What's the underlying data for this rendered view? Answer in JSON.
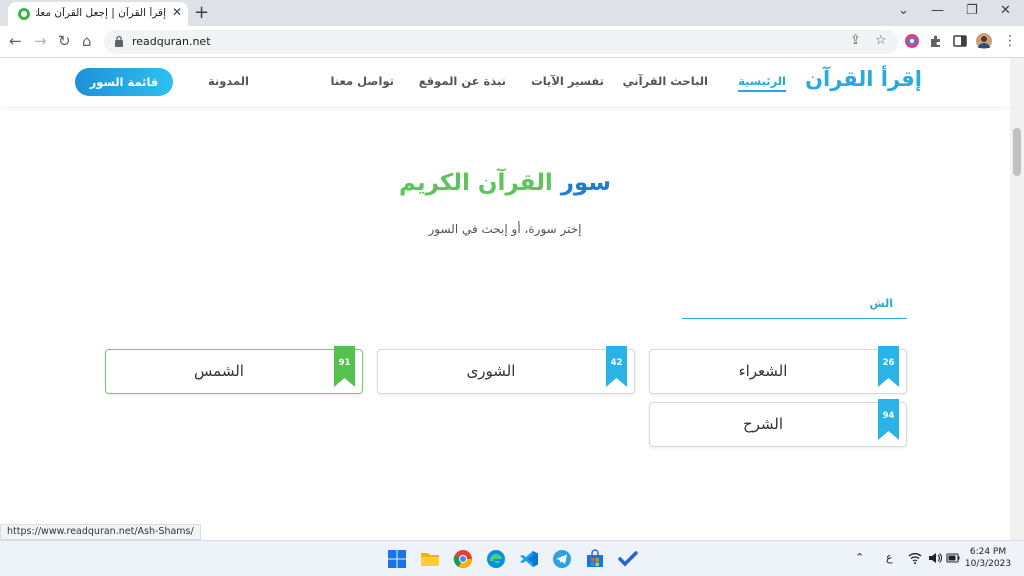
{
  "browser": {
    "tab_title": "إقرأ القرآن | إجعل القرآن معك في كل مكان",
    "tab_close": "✕",
    "new_tab": "+",
    "url": "readquran.net",
    "status_url": "https://www.readquran.net/Ash-Shams/",
    "window_controls": {
      "dropdown": "⌄",
      "minimize": "—",
      "restore": "❐",
      "close": "✕"
    },
    "nav": {
      "back": "←",
      "forward": "→",
      "reload": "↻",
      "home": "⌂"
    },
    "omnibox_icons": {
      "share": "⇪",
      "star": "☆"
    },
    "menu": "⋮"
  },
  "site": {
    "logo": "إقرأ القرآن",
    "nav": [
      {
        "label": "الرئيسية",
        "active": true
      },
      {
        "label": "الباحث القرآني",
        "active": false
      },
      {
        "label": "تفسير الآيات",
        "active": false
      },
      {
        "label": "نبذة عن الموقع",
        "active": false
      },
      {
        "label": "تواصل معنا",
        "active": false
      },
      {
        "label": "المدونة",
        "active": false
      }
    ],
    "cta": "قائمة السور",
    "accent": "#2aa8e0"
  },
  "main": {
    "title_part1": "سور",
    "title_part2": "القرآن الكريم",
    "subtitle": "إختر سورة، أو إبحث في السور",
    "search_value": "الش",
    "results": [
      {
        "name": "الشعراء",
        "number": "26",
        "color": "#2ab3e8"
      },
      {
        "name": "الشورى",
        "number": "42",
        "color": "#2ab3e8"
      },
      {
        "name": "الشمس",
        "number": "91",
        "color": "#55c24e"
      },
      {
        "name": "الشرح",
        "number": "94",
        "color": "#2ab3e8"
      }
    ]
  },
  "taskbar": {
    "lang": "ع",
    "tray_up": "⌃",
    "time": "6:24 PM",
    "date": "10/3/2023"
  }
}
